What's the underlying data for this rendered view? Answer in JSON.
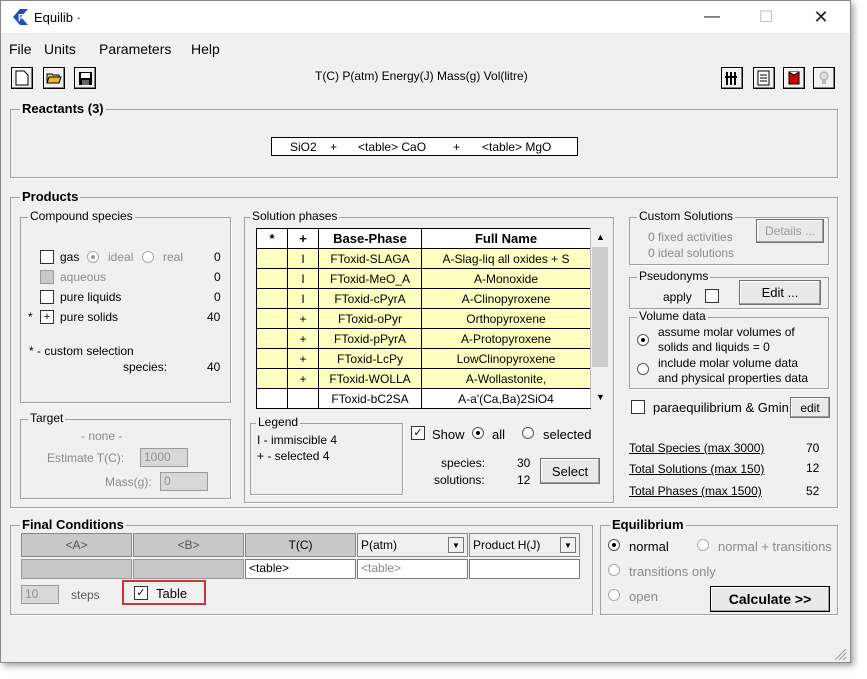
{
  "window": {
    "title": "Equilib ·"
  },
  "menu": [
    "File",
    "Units",
    "Parameters",
    "Help"
  ],
  "units_line": "T(C) P(atm) Energy(J) Mass(g) Vol(litre)",
  "reactants": {
    "title": "Reactants  (3)",
    "items": [
      "SiO2",
      "+",
      "<table> CaO",
      "+",
      "<table> MgO"
    ]
  },
  "products": {
    "title": "Products",
    "compound": {
      "title": "Compound species",
      "gas_label": "gas",
      "ideal_label": "ideal",
      "real_label": "real",
      "gas_count": "0",
      "aqueous_label": "aqueous",
      "aqueous_count": "0",
      "pure_liquids_label": "pure liquids",
      "pure_liquids_count": "0",
      "star": "*",
      "pure_solids_label": "pure solids",
      "pure_solids_mark": "+",
      "pure_solids_count": "40",
      "custom_note": "* - custom selection",
      "species_label": "species:",
      "species_count": "40"
    },
    "target": {
      "title": "Target",
      "none": "- none -",
      "estimate_label": "Estimate T(C):",
      "estimate_value": "1000",
      "mass_label": "Mass(g):",
      "mass_value": "0"
    },
    "solution": {
      "title": "Solution phases",
      "headers": [
        "*",
        "+",
        "Base-Phase",
        "Full Name"
      ],
      "rows": [
        [
          "",
          "I",
          "FToxid-SLAGA",
          "A-Slag-liq all oxides + S"
        ],
        [
          "",
          "I",
          "FToxid-MeO_A",
          "A-Monoxide"
        ],
        [
          "",
          "I",
          "FToxid-cPyrA",
          "A-Clinopyroxene"
        ],
        [
          "",
          "+",
          "FToxid-oPyr",
          "Orthopyroxene"
        ],
        [
          "",
          "+",
          "FToxid-pPyrA",
          "A-Protopyroxene"
        ],
        [
          "",
          "+",
          "FToxid-LcPy",
          "LowClinopyroxene"
        ],
        [
          "",
          "+",
          "FToxid-WOLLA",
          "A-Wollastonite,"
        ],
        [
          "",
          "",
          "FToxid-bC2SA",
          "A-a'(Ca,Ba)2SiO4"
        ]
      ]
    },
    "legend": {
      "title": "Legend",
      "line1": "I - immiscible  4",
      "line2": "+ - selected   4"
    },
    "show": {
      "label": "Show",
      "all": "all",
      "selected": "selected",
      "species_label": "species:",
      "species_value": "30",
      "solutions_label": "solutions:",
      "solutions_value": "12",
      "select_button": "Select"
    },
    "custom_solutions": {
      "title": "Custom Solutions",
      "fixed": "0  fixed activities",
      "ideal": "0  ideal solutions",
      "details_button": "Details ..."
    },
    "pseudonyms": {
      "title": "Pseudonyms",
      "apply": "apply",
      "edit_button": "Edit ..."
    },
    "volume": {
      "title": "Volume data",
      "opt1_line1": "assume molar volumes of",
      "opt1_line2": "solids and liquids = 0",
      "opt2_line1": "include molar volume data",
      "opt2_line2": "and physical properties data"
    },
    "paraeq": {
      "label": "paraequilibrium & Gmin",
      "edit_button": "edit"
    },
    "totals": [
      {
        "label": "Total Species (max 3000)",
        "value": "70"
      },
      {
        "label": "Total Solutions (max 150)",
        "value": "12"
      },
      {
        "label": "Total Phases (max 1500)",
        "value": "52"
      }
    ]
  },
  "final_conditions": {
    "title": "Final Conditions",
    "col_a": "<A>",
    "col_b": "<B>",
    "col_t": "T(C)",
    "col_p": "P(atm)",
    "col_h": "Product H(J)",
    "t_value": "<table>",
    "p_value": "<table>",
    "steps_value": "10",
    "steps_label": "steps",
    "table_label": "Table"
  },
  "equilibrium": {
    "title": "Equilibrium",
    "normal": "normal",
    "normal_trans": "normal + transitions",
    "transitions_only": "transitions only",
    "open": "open",
    "calculate_button": "Calculate >>"
  }
}
